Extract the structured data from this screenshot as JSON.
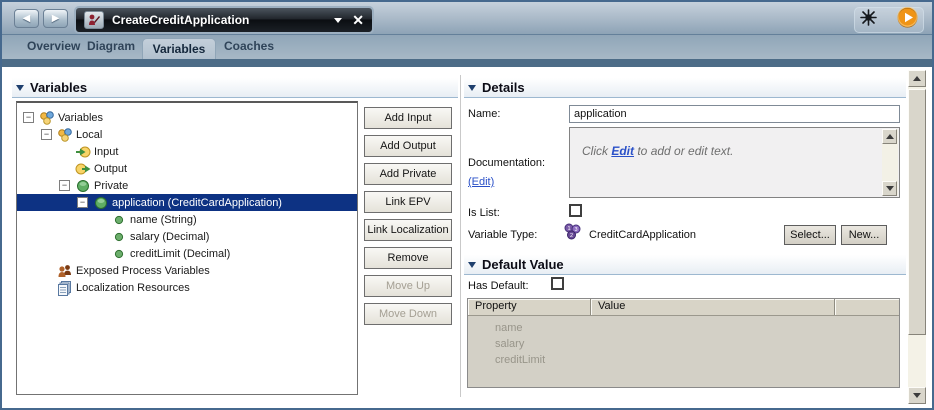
{
  "window": {
    "title": "CreateCreditApplication"
  },
  "tabs": {
    "items": [
      {
        "label": "Overview",
        "active": false
      },
      {
        "label": "Diagram",
        "active": false
      },
      {
        "label": "Variables",
        "active": true
      },
      {
        "label": "Coaches",
        "active": false
      }
    ]
  },
  "variables_panel": {
    "title": "Variables",
    "tree": [
      {
        "label": "Variables",
        "depth": 0,
        "icon": "variables-cluster",
        "expander": true,
        "selected": false
      },
      {
        "label": "Local",
        "depth": 1,
        "icon": "variables-cluster",
        "expander": true,
        "selected": false
      },
      {
        "label": "Input",
        "depth": 2,
        "icon": "input-arrow",
        "expander": false,
        "selected": false
      },
      {
        "label": "Output",
        "depth": 2,
        "icon": "output-arrow",
        "expander": false,
        "selected": false
      },
      {
        "label": "Private",
        "depth": 2,
        "icon": "private-sphere",
        "expander": true,
        "selected": false
      },
      {
        "label": "application (CreditCardApplication)",
        "depth": 3,
        "icon": "private-sphere",
        "expander": true,
        "selected": true
      },
      {
        "label": "name (String)",
        "depth": 4,
        "icon": "leaf-dot",
        "expander": false,
        "selected": false
      },
      {
        "label": "salary (Decimal)",
        "depth": 4,
        "icon": "leaf-dot",
        "expander": false,
        "selected": false
      },
      {
        "label": "creditLimit (Decimal)",
        "depth": 4,
        "icon": "leaf-dot",
        "expander": false,
        "selected": false
      },
      {
        "label": "Exposed Process Variables",
        "depth": 1,
        "icon": "exposed-people",
        "expander": false,
        "selected": false
      },
      {
        "label": "Localization Resources",
        "depth": 1,
        "icon": "localization-docs",
        "expander": false,
        "selected": false
      }
    ],
    "buttons": [
      {
        "label": "Add Input",
        "enabled": true
      },
      {
        "label": "Add Output",
        "enabled": true
      },
      {
        "label": "Add Private",
        "enabled": true
      },
      {
        "label": "Link EPV",
        "enabled": true
      },
      {
        "label": "Link Localization",
        "enabled": true
      },
      {
        "label": "Remove",
        "enabled": true
      },
      {
        "label": "Move Up",
        "enabled": false
      },
      {
        "label": "Move Down",
        "enabled": false
      }
    ]
  },
  "details_panel": {
    "title": "Details",
    "name_label": "Name:",
    "name_value": "application",
    "documentation_label": "Documentation:",
    "edit_link": "(Edit)",
    "doc_placeholder": {
      "prefix": "Click ",
      "link": "Edit",
      "suffix": " to add or edit text."
    },
    "is_list_label": "Is List:",
    "is_list_checked": false,
    "variable_type_label": "Variable Type:",
    "variable_type_value": "CreditCardApplication",
    "select_button": "Select...",
    "new_button": "New..."
  },
  "default_value_panel": {
    "title": "Default Value",
    "has_default_label": "Has Default:",
    "has_default_checked": false,
    "table": {
      "columns": [
        "Property",
        "Value"
      ],
      "rows": [
        {
          "property": "name",
          "value": ""
        },
        {
          "property": "salary",
          "value": ""
        },
        {
          "property": "creditLimit",
          "value": ""
        }
      ]
    }
  },
  "colors": {
    "selection": "#0d3283",
    "band": "#4d6c87",
    "tab_active_bg": "#b6c4d1",
    "play_button": "#ef9416"
  }
}
